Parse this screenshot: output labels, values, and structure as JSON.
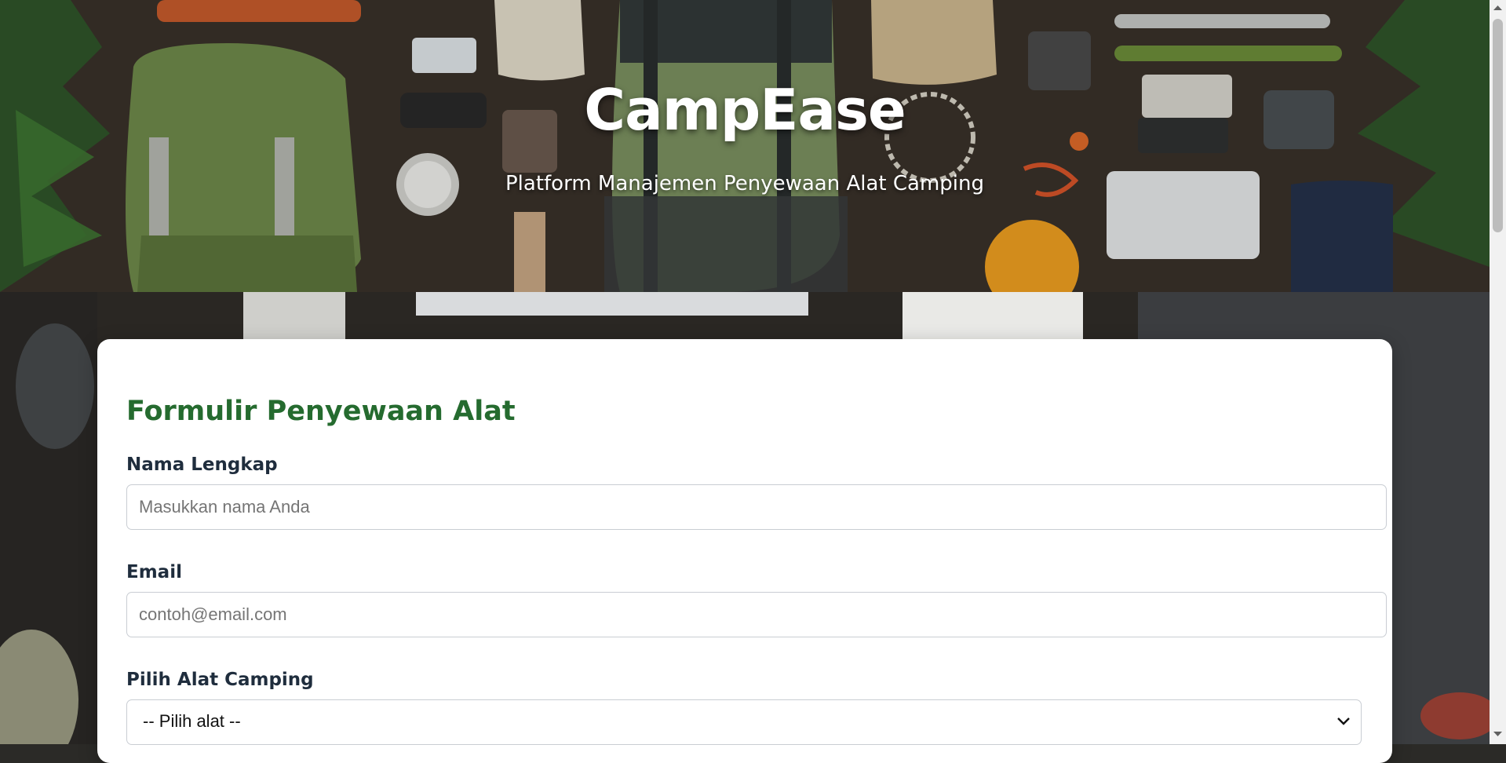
{
  "hero": {
    "title": "CampEase",
    "subtitle": "Platform Manajemen Penyewaan Alat Camping"
  },
  "form": {
    "title": "Formulir Penyewaan Alat",
    "fields": [
      {
        "label": "Nama Lengkap",
        "placeholder": "Masukkan nama Anda",
        "value": ""
      },
      {
        "label": "Email",
        "placeholder": "contoh@email.com",
        "value": ""
      }
    ],
    "equipment_select": {
      "label": "Pilih Alat Camping",
      "selected": "-- Pilih alat --"
    }
  },
  "colors": {
    "form_title": "#256b2f",
    "label": "#1f2d3d",
    "card_bg": "#ffffff"
  }
}
